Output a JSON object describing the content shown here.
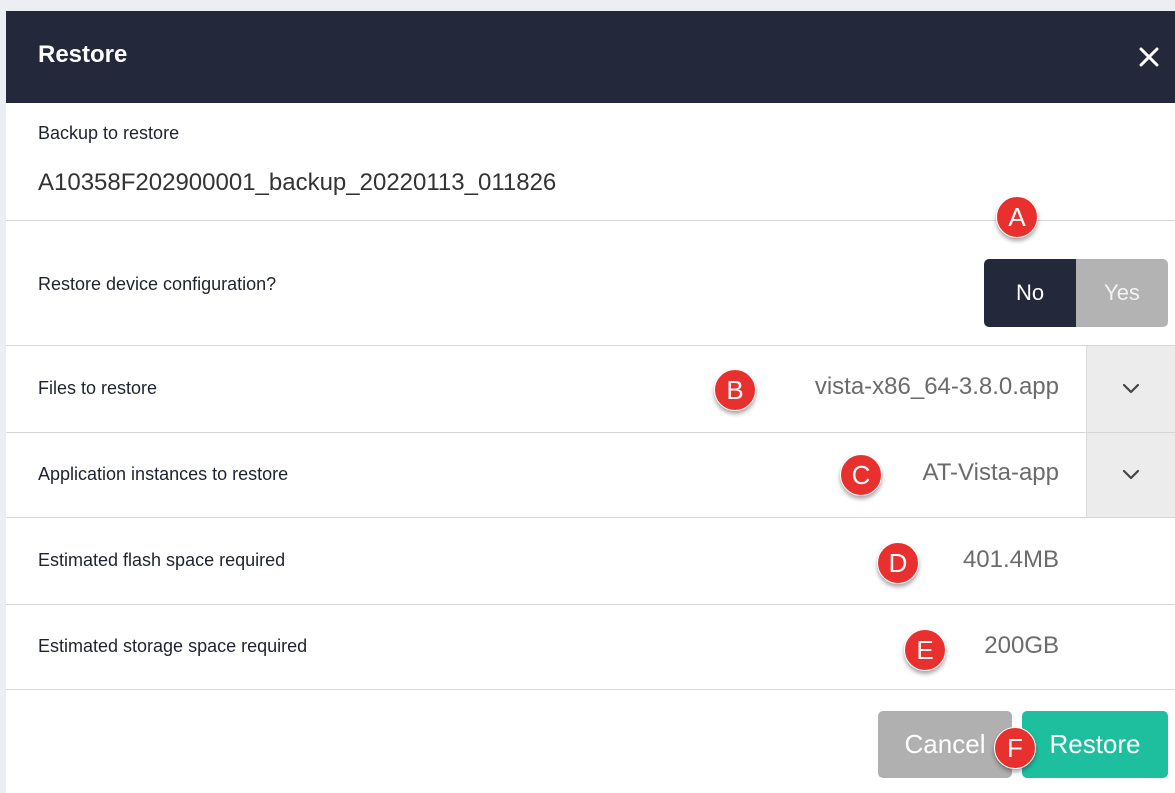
{
  "dialog": {
    "title": "Restore",
    "close_icon": "close-icon"
  },
  "backup": {
    "label": "Backup to restore",
    "value": "A10358F202900001_backup_20220113_011826"
  },
  "device_config": {
    "label": "Restore device configuration?",
    "options": [
      "No",
      "Yes"
    ],
    "selected": "No"
  },
  "files": {
    "label": "Files to restore",
    "value": "vista-x86_64-3.8.0.app",
    "chevron_icon": "chevron-down-icon"
  },
  "instances": {
    "label": "Application instances to restore",
    "value": "AT-Vista-app",
    "chevron_icon": "chevron-down-icon"
  },
  "flash": {
    "label": "Estimated flash space required",
    "value": "401.4MB"
  },
  "storage": {
    "label": "Estimated storage space required",
    "value": "200GB"
  },
  "footer": {
    "cancel_label": "Cancel",
    "restore_label": "Restore"
  },
  "markers": [
    "A",
    "B",
    "C",
    "D",
    "E",
    "F"
  ],
  "colors": {
    "header_bg": "#24283b",
    "toggle_selected": "#24283b",
    "toggle_unselected": "#b3b3b3",
    "restore_button": "#1dbf9f",
    "cancel_button": "#b0b0b0",
    "marker": "#e8312f"
  }
}
